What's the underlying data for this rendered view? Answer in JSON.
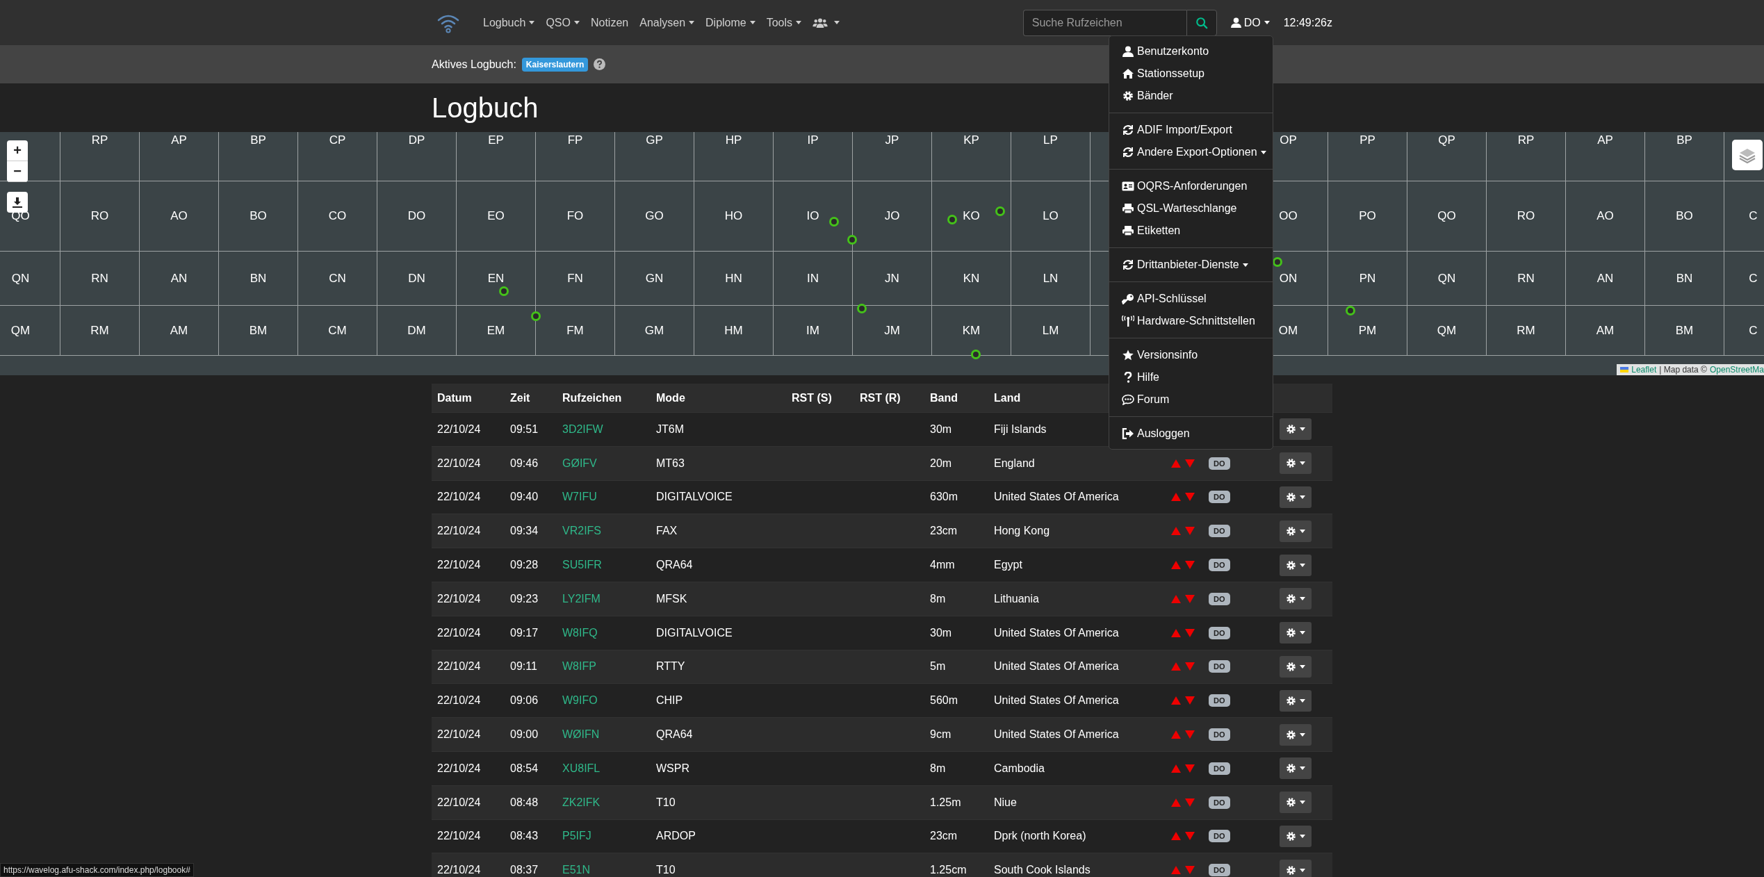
{
  "navbar": {
    "menu": [
      {
        "kind": "text",
        "label": "Logbuch",
        "dropdown": true
      },
      {
        "kind": "text",
        "label": "QSO",
        "dropdown": true
      },
      {
        "kind": "text",
        "label": "Notizen",
        "dropdown": false
      },
      {
        "kind": "text",
        "label": "Analysen",
        "dropdown": true
      },
      {
        "kind": "text",
        "label": "Diplome",
        "dropdown": true
      },
      {
        "kind": "text",
        "label": "Tools",
        "dropdown": true
      },
      {
        "kind": "users",
        "dropdown": true
      }
    ],
    "search": {
      "placeholder": "Suche Rufzeichen"
    },
    "user": {
      "label": "DO",
      "expanded": true
    },
    "clock": "12:49:26z"
  },
  "active_logbook": {
    "label": "Aktives Logbuch:",
    "badge": "Kaiserslautern"
  },
  "page_title": "Logbuch",
  "map": {
    "zoom_in": "+",
    "zoom_out": "−",
    "grid_rows": [
      {
        "left": [
          "RP",
          "AP",
          "BP",
          "CP",
          "DP",
          "EP",
          "FP",
          "GP",
          "HP",
          "IP",
          "JP",
          "KP",
          "LP"
        ],
        "right": [
          "OP",
          "PP",
          "QP",
          "RP",
          "AP",
          "BP"
        ]
      },
      {
        "left": [
          "QO",
          "RO",
          "AO",
          "BO",
          "CO",
          "DO",
          "EO",
          "FO",
          "GO",
          "HO",
          "IO",
          "JO",
          "KO",
          "LO"
        ],
        "right": [
          "OO",
          "PO",
          "QO",
          "RO",
          "AO",
          "BO",
          "C"
        ]
      },
      {
        "left": [
          "QN",
          "RN",
          "AN",
          "BN",
          "CN",
          "DN",
          "EN",
          "FN",
          "GN",
          "HN",
          "IN",
          "JN",
          "KN",
          "LN"
        ],
        "right": [
          "ON",
          "PN",
          "QN",
          "RN",
          "AN",
          "BN",
          "C"
        ]
      },
      {
        "left": [
          "QM",
          "RM",
          "AM",
          "BM",
          "CM",
          "DM",
          "EM",
          "FM",
          "GM",
          "HM",
          "IM",
          "JM",
          "KM",
          "LM"
        ],
        "right": [
          "OM",
          "PM",
          "QM",
          "RM",
          "AM",
          "BM",
          "C"
        ]
      }
    ],
    "attribution": {
      "link": "Leaflet",
      "text": "| Map data ©",
      "source": "OpenStreetMa"
    }
  },
  "user_menu": {
    "sections": [
      {
        "items": [
          {
            "kind": "user",
            "label": "Benutzerkonto",
            "submenu": false
          },
          {
            "kind": "home",
            "label": "Stationssetup",
            "submenu": false
          },
          {
            "kind": "gear",
            "label": "Bänder",
            "submenu": false
          }
        ]
      },
      {
        "items": [
          {
            "kind": "sync",
            "label": "ADIF Import/Export",
            "submenu": false
          },
          {
            "kind": "sync",
            "label": "Andere Export-Optionen",
            "submenu": true
          }
        ]
      },
      {
        "items": [
          {
            "kind": "card",
            "label": "OQRS-Anforderungen",
            "submenu": false
          },
          {
            "kind": "print",
            "label": "QSL-Warteschlange",
            "submenu": false
          },
          {
            "kind": "print",
            "label": "Etiketten",
            "submenu": false
          }
        ]
      },
      {
        "items": [
          {
            "kind": "sync",
            "label": "Drittanbieter-Dienste",
            "submenu": true
          }
        ]
      },
      {
        "items": [
          {
            "kind": "key",
            "label": "API-Schlüssel",
            "submenu": false
          },
          {
            "kind": "antenna",
            "label": "Hardware-Schnittstellen",
            "submenu": false
          }
        ]
      },
      {
        "items": [
          {
            "kind": "star",
            "label": "Versionsinfo",
            "submenu": false
          },
          {
            "kind": "question",
            "label": "Hilfe",
            "submenu": false
          },
          {
            "kind": "comment",
            "label": "Forum",
            "submenu": false
          }
        ]
      },
      {
        "items": [
          {
            "kind": "logout",
            "label": "Ausloggen",
            "submenu": false
          }
        ]
      }
    ]
  },
  "table": {
    "columns": [
      "Datum",
      "Zeit",
      "Rufzeichen",
      "Mode",
      "RST (S)",
      "RST (R)",
      "Band",
      "Land"
    ],
    "rows": [
      {
        "date": "22/10/24",
        "time": "09:51",
        "call": "3D2IFW",
        "mode": "JT6M",
        "band": "30m",
        "country": "Fiji Islands"
      },
      {
        "date": "22/10/24",
        "time": "09:46",
        "call": "GØIFV",
        "mode": "MT63",
        "band": "20m",
        "country": "England",
        "qsl_sent": false,
        "qsl_received": false,
        "station": "DO"
      },
      {
        "date": "22/10/24",
        "time": "09:40",
        "call": "W7IFU",
        "mode": "DIGITALVOICE",
        "band": "630m",
        "country": "United States Of America",
        "qsl_sent": false,
        "qsl_received": false,
        "station": "DO"
      },
      {
        "date": "22/10/24",
        "time": "09:34",
        "call": "VR2IFS",
        "mode": "FAX",
        "band": "23cm",
        "country": "Hong Kong",
        "qsl_sent": false,
        "qsl_received": false,
        "station": "DO"
      },
      {
        "date": "22/10/24",
        "time": "09:28",
        "call": "SU5IFR",
        "mode": "QRA64",
        "band": "4mm",
        "country": "Egypt",
        "qsl_sent": false,
        "qsl_received": false,
        "station": "DO"
      },
      {
        "date": "22/10/24",
        "time": "09:23",
        "call": "LY2IFM",
        "mode": "MFSK",
        "band": "8m",
        "country": "Lithuania",
        "qsl_sent": false,
        "qsl_received": false,
        "station": "DO"
      },
      {
        "date": "22/10/24",
        "time": "09:17",
        "call": "W8IFQ",
        "mode": "DIGITALVOICE",
        "band": "30m",
        "country": "United States Of America",
        "qsl_sent": false,
        "qsl_received": false,
        "station": "DO"
      },
      {
        "date": "22/10/24",
        "time": "09:11",
        "call": "W8IFP",
        "mode": "RTTY",
        "band": "5m",
        "country": "United States Of America",
        "qsl_sent": false,
        "qsl_received": false,
        "station": "DO"
      },
      {
        "date": "22/10/24",
        "time": "09:06",
        "call": "W9IFO",
        "mode": "CHIP",
        "band": "560m",
        "country": "United States Of America",
        "qsl_sent": false,
        "qsl_received": false,
        "station": "DO"
      },
      {
        "date": "22/10/24",
        "time": "09:00",
        "call": "WØIFN",
        "mode": "QRA64",
        "band": "9cm",
        "country": "United States Of America",
        "qsl_sent": false,
        "qsl_received": false,
        "station": "DO"
      },
      {
        "date": "22/10/24",
        "time": "08:54",
        "call": "XU8IFL",
        "mode": "WSPR",
        "band": "8m",
        "country": "Cambodia",
        "qsl_sent": false,
        "qsl_received": false,
        "station": "DO"
      },
      {
        "date": "22/10/24",
        "time": "08:48",
        "call": "ZK2IFK",
        "mode": "T10",
        "band": "1.25m",
        "country": "Niue",
        "qsl_sent": false,
        "qsl_received": false,
        "station": "DO"
      },
      {
        "date": "22/10/24",
        "time": "08:43",
        "call": "P5IFJ",
        "mode": "ARDOP",
        "band": "23cm",
        "country": "Dprk (north Korea)",
        "qsl_sent": false,
        "qsl_received": false,
        "station": "DO"
      },
      {
        "date": "22/10/24",
        "time": "08:37",
        "call": "E51N",
        "mode": "T10",
        "band": "1.25cm",
        "country": "South Cook Islands",
        "qsl_sent": false,
        "qsl_received": false,
        "station": "DO"
      }
    ]
  },
  "status_url": "https://wavelog.afu-shack.com/index.php/logbook#"
}
